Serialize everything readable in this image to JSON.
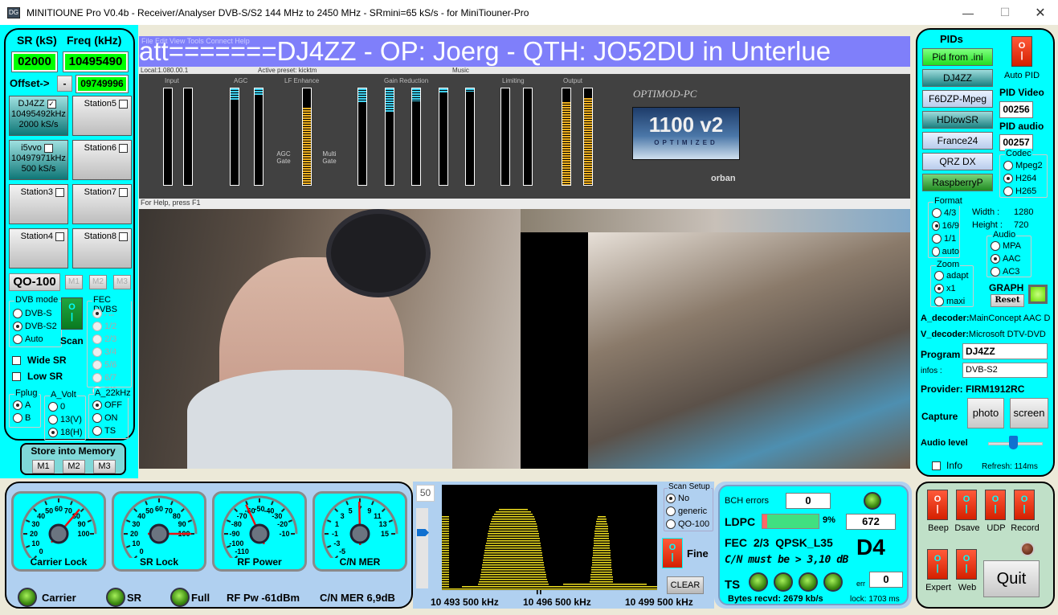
{
  "window": {
    "title": "MINITIOUNE Pro V0.4b - Receiver/Analyser DVB-S/S2 144 MHz to 2450 MHz - SRmini=65 kS/s - for MiniTiouner-Pro",
    "icon": "app-icon",
    "minimize": "—",
    "maximize": "☐",
    "close": "✕"
  },
  "left": {
    "sr_label": "SR (kS)",
    "freq_label": "Freq (kHz)",
    "sr_value": "02000",
    "freq_value": "10495490",
    "offset_label": "Offset->",
    "offset_sign": "-",
    "offset_value": "09749996",
    "stations": [
      {
        "name": "DJ4ZZ",
        "checked": true,
        "freq": "10495492kHz",
        "sr": "2000 kS/s",
        "active": true
      },
      {
        "name": "i5vvo",
        "checked": false,
        "freq": "10497971kHz",
        "sr": "500 kS/s",
        "active": true
      },
      {
        "name": "Station3",
        "checked": false,
        "freq": "",
        "sr": "",
        "active": false
      },
      {
        "name": "Station4",
        "checked": false,
        "freq": "",
        "sr": "",
        "active": false
      },
      {
        "name": "Station5",
        "checked": false,
        "freq": "",
        "sr": "",
        "active": false
      },
      {
        "name": "Station6",
        "checked": false,
        "freq": "",
        "sr": "",
        "active": false
      },
      {
        "name": "Station7",
        "checked": false,
        "freq": "",
        "sr": "",
        "active": false
      },
      {
        "name": "Station8",
        "checked": false,
        "freq": "",
        "sr": "",
        "active": false
      }
    ],
    "qo100": "QO-100",
    "mem_buttons": [
      "M1",
      "M2",
      "M3"
    ],
    "dvb_mode": {
      "title": "DVB mode",
      "options": [
        "DVB-S",
        "DVB-S2",
        "Auto"
      ],
      "selected": "DVB-S2"
    },
    "scan_label": "Scan",
    "fec_dvbs": {
      "title": "FEC DVBS",
      "options": [
        "All",
        "1/2",
        "2/3",
        "3/4",
        "5/6",
        "6/7",
        "7/8"
      ],
      "selected": "All"
    },
    "wide_sr": "Wide SR",
    "low_sr": "Low SR",
    "fplug": {
      "title": "Fplug",
      "options": [
        "A",
        "B"
      ],
      "selected": "A"
    },
    "a_volt": {
      "title": "A_Volt",
      "options": [
        "0",
        "13(V)",
        "18(H)"
      ],
      "selected": "18(H)"
    },
    "a_22khz": {
      "title": "A_22kHz",
      "options": [
        "OFF",
        "ON",
        "TS"
      ],
      "selected": "OFF"
    },
    "store_title": "Store into Memory",
    "store_buttons": [
      "M1",
      "M2",
      "M3"
    ]
  },
  "video": {
    "ticker": "att=======DJ4ZZ - OP: Joerg - QTH: JO52DU in Unterlue",
    "menu_overlay": "File  Edit  View  Tools  Connect  Help",
    "status_left": "Local:1.080.00.1",
    "status_mid": "Active preset: kicktm",
    "status_right": "Music",
    "help": "For Help, press F1",
    "optimod": {
      "brand": "OPTIMOD-PC",
      "badge": "1100 v2",
      "badge_sub": "OPTIMIZED",
      "maker": "orban",
      "sections": [
        "Input",
        "AGC",
        "LF Enhance",
        "Gain Reduction",
        "Limiting",
        "Output"
      ],
      "agc_gate": "AGC Gate",
      "multi_gate": "Multi Gate"
    }
  },
  "right": {
    "pids_title": "PIDs",
    "pid_buttons": [
      {
        "label": "Pid from .ini",
        "style": "green"
      },
      {
        "label": "DJ4ZZ",
        "style": "teal"
      },
      {
        "label": "F6DZP-Mpeg",
        "style": "light"
      },
      {
        "label": "HDlowSR",
        "style": "teal"
      },
      {
        "label": "France24",
        "style": "light"
      },
      {
        "label": "QRZ DX",
        "style": "light"
      },
      {
        "label": "RaspberryP",
        "style": "dg"
      }
    ],
    "auto_pid": "Auto PID",
    "pid_video_label": "PID Video",
    "pid_video": "00256",
    "pid_audio_label": "PID audio",
    "pid_audio": "00257",
    "codec": {
      "title": "Codec",
      "options": [
        "Mpeg2",
        "H264",
        "H265"
      ],
      "selected": "H264"
    },
    "format": {
      "title": "Format",
      "options": [
        "4/3",
        "16/9",
        "1/1",
        "auto"
      ],
      "selected": "16/9"
    },
    "width_label": "Width :",
    "width": "1280",
    "height_label": "Height :",
    "height": "720",
    "audio": {
      "title": "Audio",
      "options": [
        "MPA",
        "AAC",
        "AC3"
      ],
      "selected": "AAC"
    },
    "zoom": {
      "title": "Zoom",
      "options": [
        "adapt",
        "x1",
        "maxi"
      ],
      "selected": "x1"
    },
    "graph": "GRAPH",
    "reset": "Reset",
    "a_decoder_label": "A_decoder:",
    "a_decoder": "MainConcept AAC D",
    "v_decoder_label": "V_decoder:",
    "v_decoder": "Microsoft DTV-DVD",
    "program_label": "Program",
    "program": "DJ4ZZ",
    "infos_label": "infos :",
    "infos": "DVB-S2",
    "provider_label": "Provider:",
    "provider": "FIRM1912RC",
    "capture_label": "Capture",
    "photo": "photo",
    "screen": "screen",
    "audio_level_label": "Audio level",
    "audio_level": 0.45,
    "info_label": "Info",
    "refresh": "Refresh:  114ms"
  },
  "gauges": [
    {
      "name": "Carrier Lock",
      "ticks": [
        "0",
        "10",
        "20",
        "30",
        "40",
        "50",
        "60",
        "70",
        "80",
        "90",
        "100"
      ],
      "value": 78
    },
    {
      "name": "SR Lock",
      "ticks": [
        "0",
        "10",
        "20",
        "30",
        "40",
        "50",
        "60",
        "70",
        "80",
        "90",
        "100"
      ],
      "value": 100
    },
    {
      "name": "RF Power",
      "ticks": [
        "-110",
        "-100",
        "-90",
        "-80",
        "-70",
        "-60",
        "-50",
        "-40",
        "-30",
        "-20",
        "-10"
      ],
      "value": -61
    },
    {
      "name": "C/N MER",
      "ticks": [
        "-5",
        "-3",
        "-1",
        "1",
        "3",
        "5",
        "7",
        "9",
        "11",
        "13",
        "15"
      ],
      "value": 6.9
    }
  ],
  "status_leds": [
    {
      "label": "Carrier"
    },
    {
      "label": "SR"
    },
    {
      "label": "Full"
    }
  ],
  "rf_pw": "RF Pw  -61dBm",
  "cn_mer": "C/N MER 6,9dB",
  "spectrum": {
    "gain": "50",
    "scan_setup": {
      "title": "Scan Setup",
      "options": [
        "No",
        "generic",
        "QO-100"
      ],
      "selected": "No"
    },
    "fine": "Fine",
    "clear": "CLEAR",
    "freq_left": "10 493 500 kHz",
    "freq_mid": "10 496 500 kHz",
    "freq_right": "10 499 500 kHz",
    "marker": "⇈"
  },
  "decoder": {
    "bch_label": "BCH errors",
    "bch": "0",
    "ldpc_label": "LDPC",
    "ldpc_pct": "9%",
    "ldpc_fraction": 0.09,
    "ldpc_count": "672",
    "fec": "FEC  2/3 QPSK_L35",
    "cn_must": "C/N must be > 3,10 dB",
    "dcode": "D4",
    "ts_label": "TS",
    "err_label": "err",
    "err": "0",
    "bytes": "Bytes recvd:  2679 kb/s",
    "lock": "lock:  1703 ms"
  },
  "switches": {
    "items": [
      "Beep",
      "Dsave",
      "UDP",
      "Record",
      "Expert",
      "Web"
    ],
    "quit": "Quit"
  }
}
